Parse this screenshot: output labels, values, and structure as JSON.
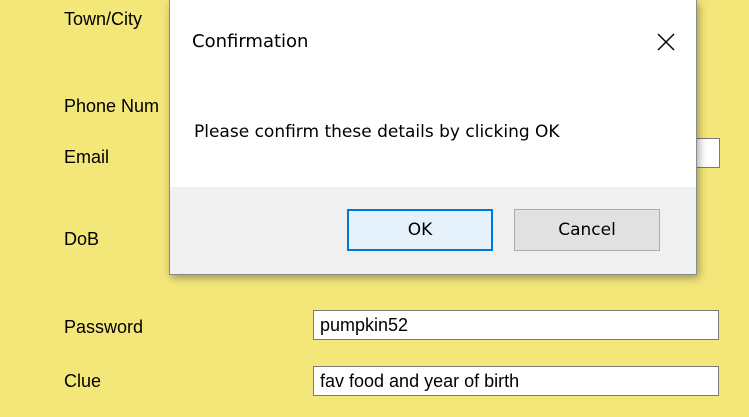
{
  "form": {
    "town_label": "Town/City",
    "phone_label": "Phone Num",
    "email_label": "Email",
    "dob_label": "DoB",
    "password_label": "Password",
    "password_value": "pumpkin52",
    "clue_label": "Clue",
    "clue_value": "fav food and year of birth"
  },
  "dialog": {
    "title": "Confirmation",
    "close_icon": "close-icon",
    "message": "Please confirm these details by clicking OK",
    "ok_label": "OK",
    "cancel_label": "Cancel"
  },
  "colors": {
    "form_background": "#f3e77a",
    "dialog_background": "#ffffff",
    "footer_background": "#f0f0f0",
    "ok_focus_border": "#0078d7"
  }
}
